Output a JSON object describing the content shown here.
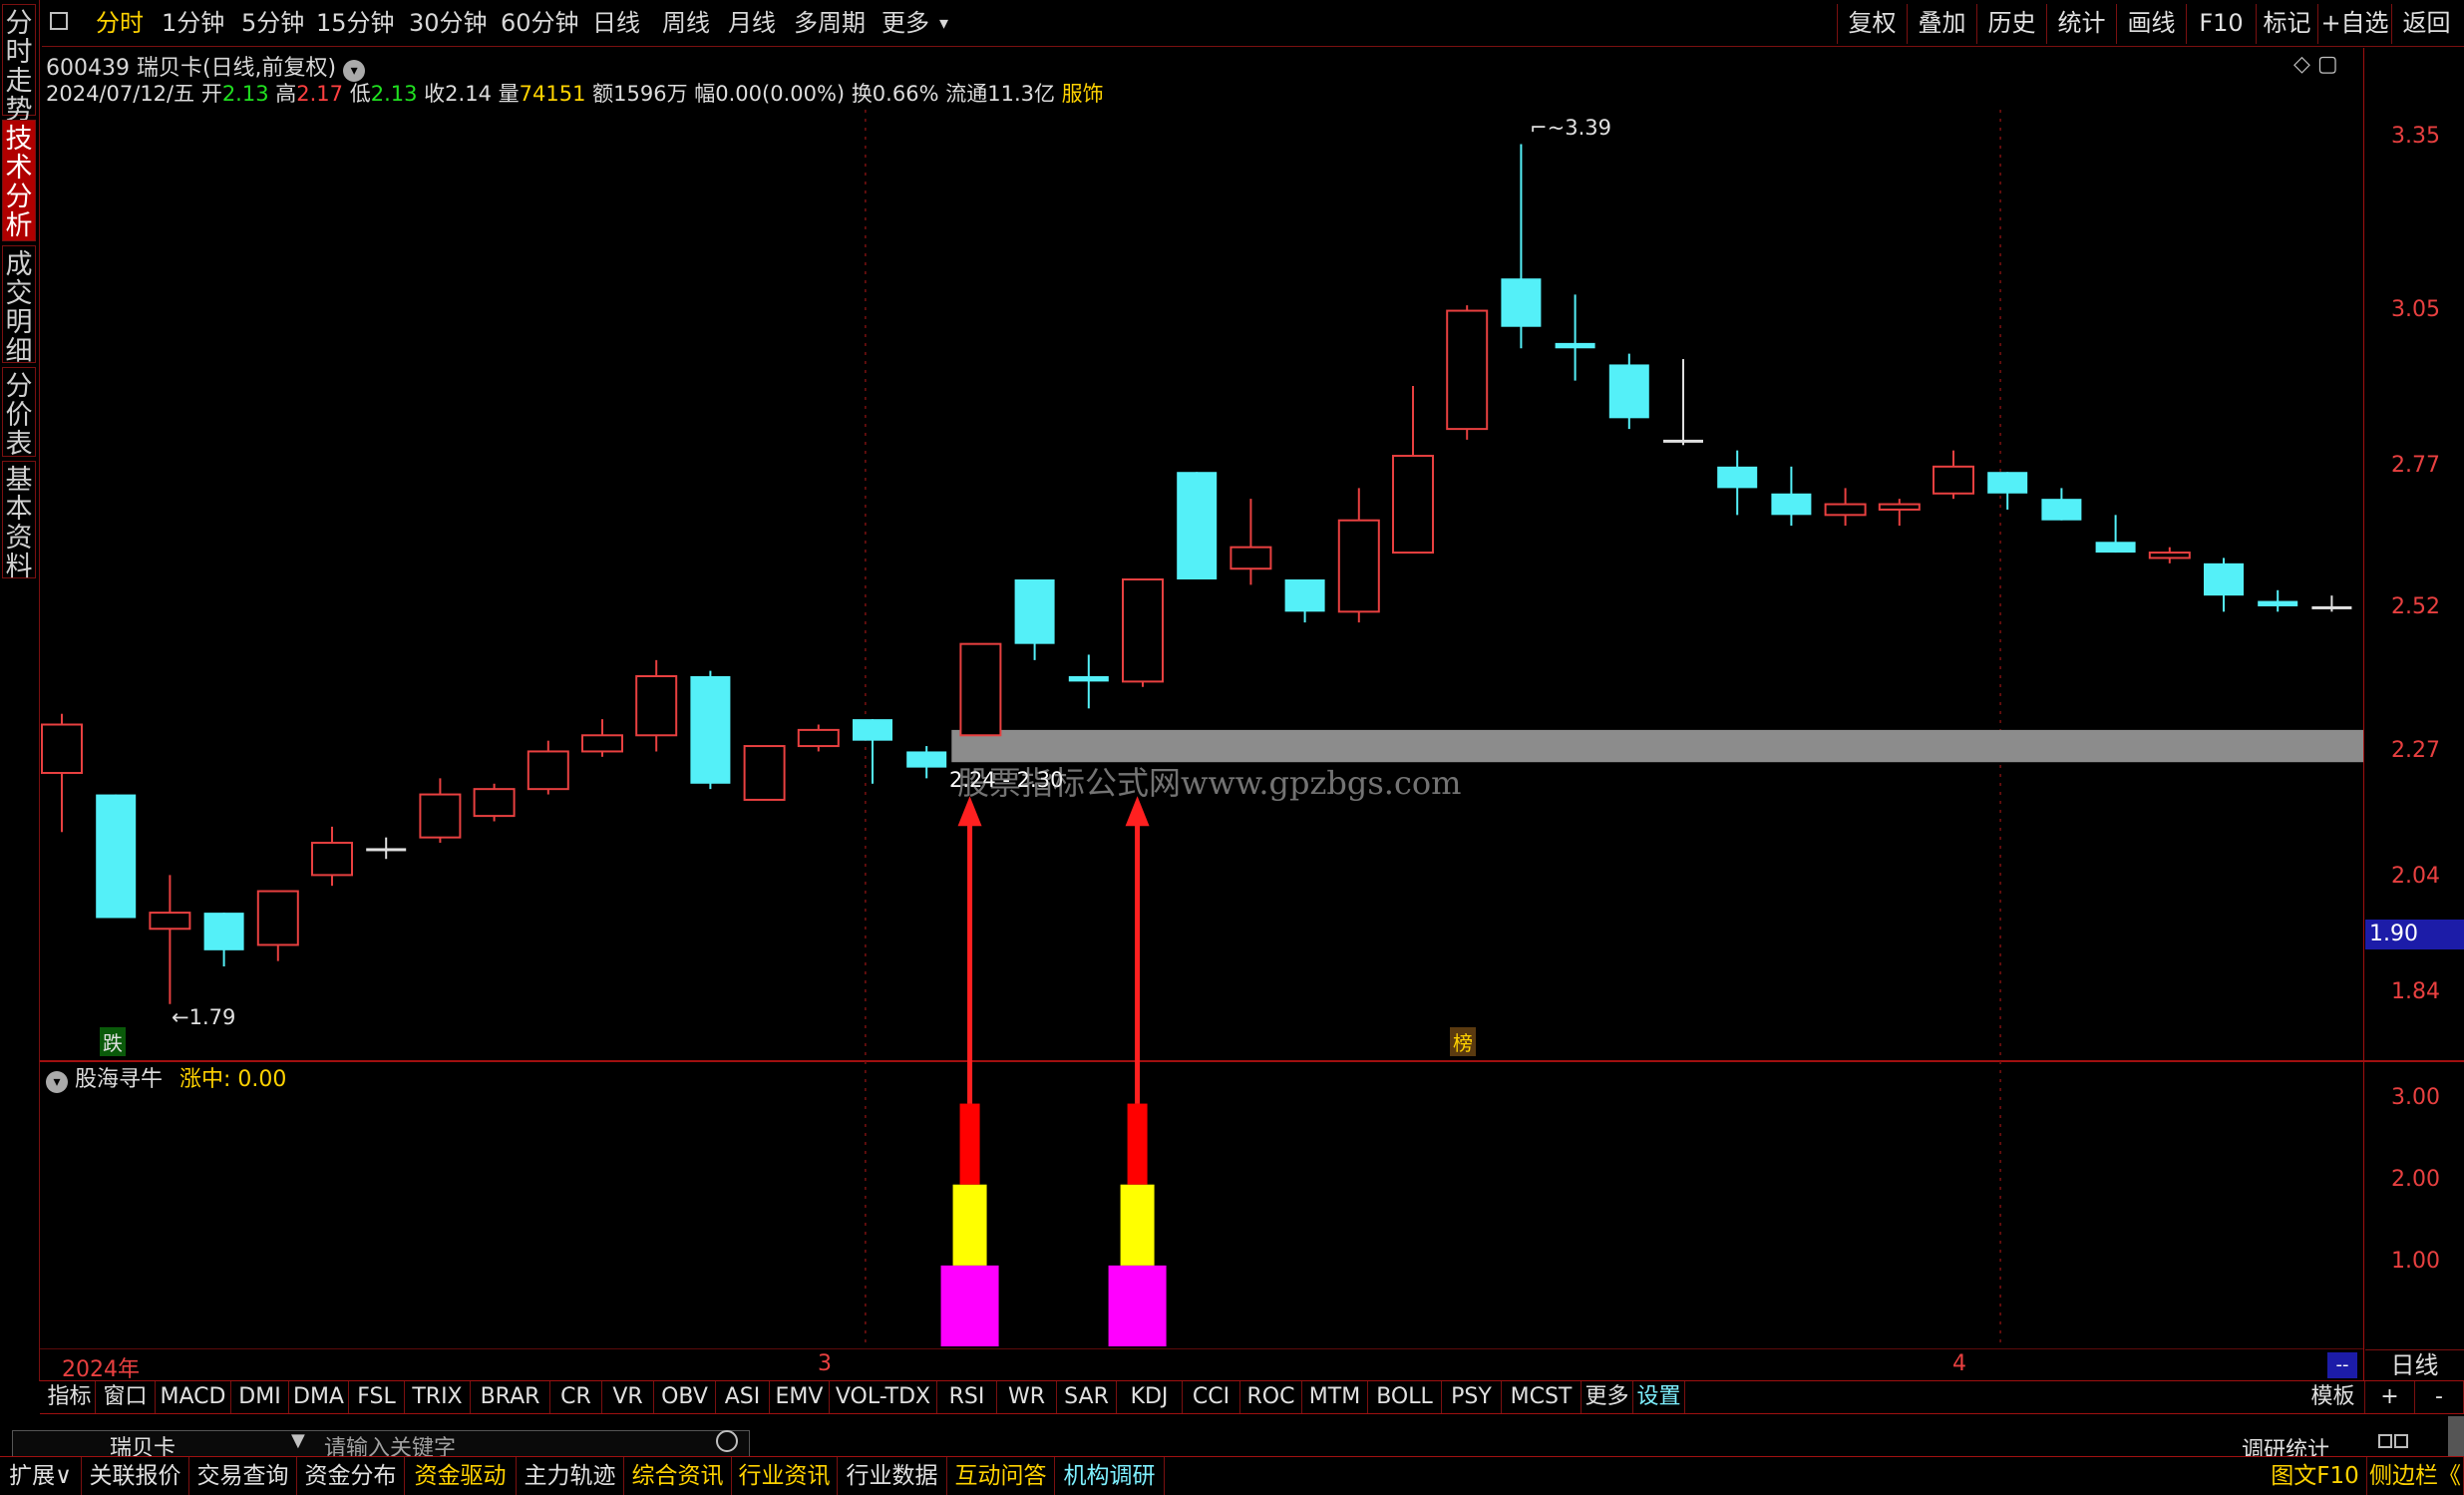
{
  "left_tabs": [
    {
      "label": "分时走势",
      "active": false
    },
    {
      "label": "技术分析",
      "active": true
    },
    {
      "label": "成交明细",
      "active": false
    },
    {
      "label": "分价表",
      "active": false
    },
    {
      "label": "基本资料",
      "active": false
    }
  ],
  "top_bar": {
    "periods": [
      "分时",
      "1分钟",
      "5分钟",
      "15分钟",
      "30分钟",
      "60分钟",
      "日线",
      "周线",
      "月线",
      "多周期",
      "更多"
    ],
    "selected_period": "分时",
    "more_arrow": "▾",
    "right_buttons": [
      "复权",
      "叠加",
      "历史",
      "统计",
      "画线",
      "F10",
      "标记",
      "+自选",
      "返回"
    ]
  },
  "stock": {
    "code_name": "600439 瑞贝卡(日线,前复权)",
    "date": "2024/07/12/五",
    "open_label": "开",
    "open": "2.13",
    "high_label": "高",
    "high": "2.17",
    "low_label": "低",
    "low": "2.13",
    "close_label": "收",
    "close": "2.14",
    "vol_label": "量",
    "vol": "74151",
    "amount": "额1596万",
    "change": "幅0.00(0.00%)",
    "turnover": "换0.66%",
    "float_cap": "流通11.3亿",
    "industry": "服饰"
  },
  "window_icons": "◇ ▢",
  "price_axis": {
    "ticks": [
      "3.35",
      "3.05",
      "2.77",
      "2.52",
      "2.27",
      "2.04",
      "1.84"
    ],
    "current": "1.90"
  },
  "annotations": {
    "high_label": "3.39",
    "low_label": "1.79",
    "range_label": "2.24 - 2.30",
    "watermark": "股票指标公式网www.gpzbgs.com",
    "badge_fall": "跌",
    "badge_rank": "榜"
  },
  "colors": {
    "up": "#e84040",
    "down": "#54f0f8",
    "zone": "#8c8c8c",
    "arrow": "#ff2020",
    "bar_red": "#ff0000",
    "bar_yellow": "#ffff00",
    "bar_magenta": "#ff00ff"
  },
  "chart_data": {
    "type": "candlestick",
    "candles": [
      {
        "o": 2.22,
        "h": 2.33,
        "l": 2.11,
        "c": 2.31
      },
      {
        "o": 2.18,
        "h": 2.18,
        "l": 1.95,
        "c": 1.95
      },
      {
        "o": 1.93,
        "h": 2.03,
        "l": 1.79,
        "c": 1.96
      },
      {
        "o": 1.96,
        "h": 1.96,
        "l": 1.86,
        "c": 1.89
      },
      {
        "o": 1.9,
        "h": 2.0,
        "l": 1.87,
        "c": 2.0
      },
      {
        "o": 2.03,
        "h": 2.12,
        "l": 2.01,
        "c": 2.09
      },
      {
        "o": 2.08,
        "h": 2.1,
        "l": 2.06,
        "c": 2.08
      },
      {
        "o": 2.1,
        "h": 2.21,
        "l": 2.09,
        "c": 2.18
      },
      {
        "o": 2.14,
        "h": 2.2,
        "l": 2.13,
        "c": 2.19
      },
      {
        "o": 2.19,
        "h": 2.28,
        "l": 2.18,
        "c": 2.26
      },
      {
        "o": 2.26,
        "h": 2.32,
        "l": 2.25,
        "c": 2.29
      },
      {
        "o": 2.29,
        "h": 2.43,
        "l": 2.26,
        "c": 2.4
      },
      {
        "o": 2.4,
        "h": 2.41,
        "l": 2.19,
        "c": 2.2
      },
      {
        "o": 2.17,
        "h": 2.27,
        "l": 2.17,
        "c": 2.27
      },
      {
        "o": 2.27,
        "h": 2.31,
        "l": 2.26,
        "c": 2.3
      },
      {
        "o": 2.32,
        "h": 2.32,
        "l": 2.2,
        "c": 2.28
      },
      {
        "o": 2.26,
        "h": 2.27,
        "l": 2.21,
        "c": 2.23
      },
      {
        "o": 2.29,
        "h": 2.46,
        "l": 2.29,
        "c": 2.46
      },
      {
        "o": 2.58,
        "h": 2.58,
        "l": 2.43,
        "c": 2.46
      },
      {
        "o": 2.4,
        "h": 2.44,
        "l": 2.34,
        "c": 2.39
      },
      {
        "o": 2.39,
        "h": 2.58,
        "l": 2.38,
        "c": 2.58
      },
      {
        "o": 2.78,
        "h": 2.78,
        "l": 2.58,
        "c": 2.58
      },
      {
        "o": 2.6,
        "h": 2.73,
        "l": 2.57,
        "c": 2.64
      },
      {
        "o": 2.58,
        "h": 2.58,
        "l": 2.5,
        "c": 2.52
      },
      {
        "o": 2.52,
        "h": 2.75,
        "l": 2.5,
        "c": 2.69
      },
      {
        "o": 2.63,
        "h": 2.94,
        "l": 2.63,
        "c": 2.81
      },
      {
        "o": 2.86,
        "h": 3.09,
        "l": 2.84,
        "c": 3.08
      },
      {
        "o": 3.14,
        "h": 3.39,
        "l": 3.01,
        "c": 3.05
      },
      {
        "o": 3.02,
        "h": 3.11,
        "l": 2.95,
        "c": 3.01
      },
      {
        "o": 2.98,
        "h": 3.0,
        "l": 2.86,
        "c": 2.88
      },
      {
        "o": 2.84,
        "h": 2.99,
        "l": 2.83,
        "c": 2.84
      },
      {
        "o": 2.79,
        "h": 2.82,
        "l": 2.7,
        "c": 2.75
      },
      {
        "o": 2.74,
        "h": 2.79,
        "l": 2.68,
        "c": 2.7
      },
      {
        "o": 2.7,
        "h": 2.75,
        "l": 2.68,
        "c": 2.72
      },
      {
        "o": 2.71,
        "h": 2.73,
        "l": 2.68,
        "c": 2.72
      },
      {
        "o": 2.74,
        "h": 2.82,
        "l": 2.73,
        "c": 2.79
      },
      {
        "o": 2.78,
        "h": 2.78,
        "l": 2.71,
        "c": 2.74
      },
      {
        "o": 2.73,
        "h": 2.75,
        "l": 2.69,
        "c": 2.69
      },
      {
        "o": 2.65,
        "h": 2.7,
        "l": 2.63,
        "c": 2.63
      },
      {
        "o": 2.62,
        "h": 2.64,
        "l": 2.61,
        "c": 2.63
      },
      {
        "o": 2.61,
        "h": 2.62,
        "l": 2.52,
        "c": 2.55
      },
      {
        "o": 2.54,
        "h": 2.56,
        "l": 2.52,
        "c": 2.53
      },
      {
        "o": 2.53,
        "h": 2.55,
        "l": 2.52,
        "c": 2.53
      }
    ],
    "ylim": [
      1.68,
      3.48
    ],
    "x_labels": [
      {
        "label": "2024年",
        "index": 0
      },
      {
        "label": "3",
        "index": 14.5
      },
      {
        "label": "4",
        "index": 35.5
      }
    ],
    "zone": {
      "low": 2.24,
      "high": 2.3,
      "from_index": 16.5
    },
    "signals": [
      16.8,
      19.9
    ]
  },
  "subchart": {
    "title": "股海寻牛",
    "value_label": "涨中: 0.00",
    "ticks": [
      "3.00",
      "2.00",
      "1.00"
    ],
    "ylim": [
      0,
      3.5
    ],
    "signal_levels": [
      {
        "from": 0,
        "to": 1,
        "color": "#ff00ff"
      },
      {
        "from": 1,
        "to": 2,
        "color": "#ffff00"
      },
      {
        "from": 2,
        "to": 3,
        "color": "#ff0000"
      }
    ]
  },
  "date_row": {
    "labels": [
      "2024年",
      "3",
      "4"
    ],
    "scroll": "--",
    "period": "日线"
  },
  "indicators": [
    "指标",
    "窗口",
    "MACD",
    "DMI",
    "DMA",
    "FSL",
    "TRIX",
    "BRAR",
    "CR",
    "VR",
    "OBV",
    "ASI",
    "EMV",
    "VOL-TDX",
    "RSI",
    "WR",
    "SAR",
    "KDJ",
    "CCI",
    "ROC",
    "MTM",
    "BOLL",
    "PSY",
    "MCST",
    "更多",
    "设置"
  ],
  "indicator_right": [
    "模板",
    "+",
    "-"
  ],
  "search": {
    "name": "瑞贝卡",
    "placeholder": "请输入关键字",
    "research": "调研统计"
  },
  "bottom_bar": [
    {
      "label": "扩展∨",
      "style": "w"
    },
    {
      "label": "关联报价",
      "style": "w"
    },
    {
      "label": "交易查询",
      "style": "w"
    },
    {
      "label": "资金分布",
      "style": "w"
    },
    {
      "label": "资金驱动",
      "style": "y"
    },
    {
      "label": "主力轨迹",
      "style": "w"
    },
    {
      "label": "综合资讯",
      "style": "y"
    },
    {
      "label": "行业资讯",
      "style": "y"
    },
    {
      "label": "行业数据",
      "style": "w"
    },
    {
      "label": "互动问答",
      "style": "y"
    },
    {
      "label": "机构调研",
      "style": "c"
    }
  ],
  "bottom_right": [
    "图文F10",
    "侧边栏《"
  ]
}
